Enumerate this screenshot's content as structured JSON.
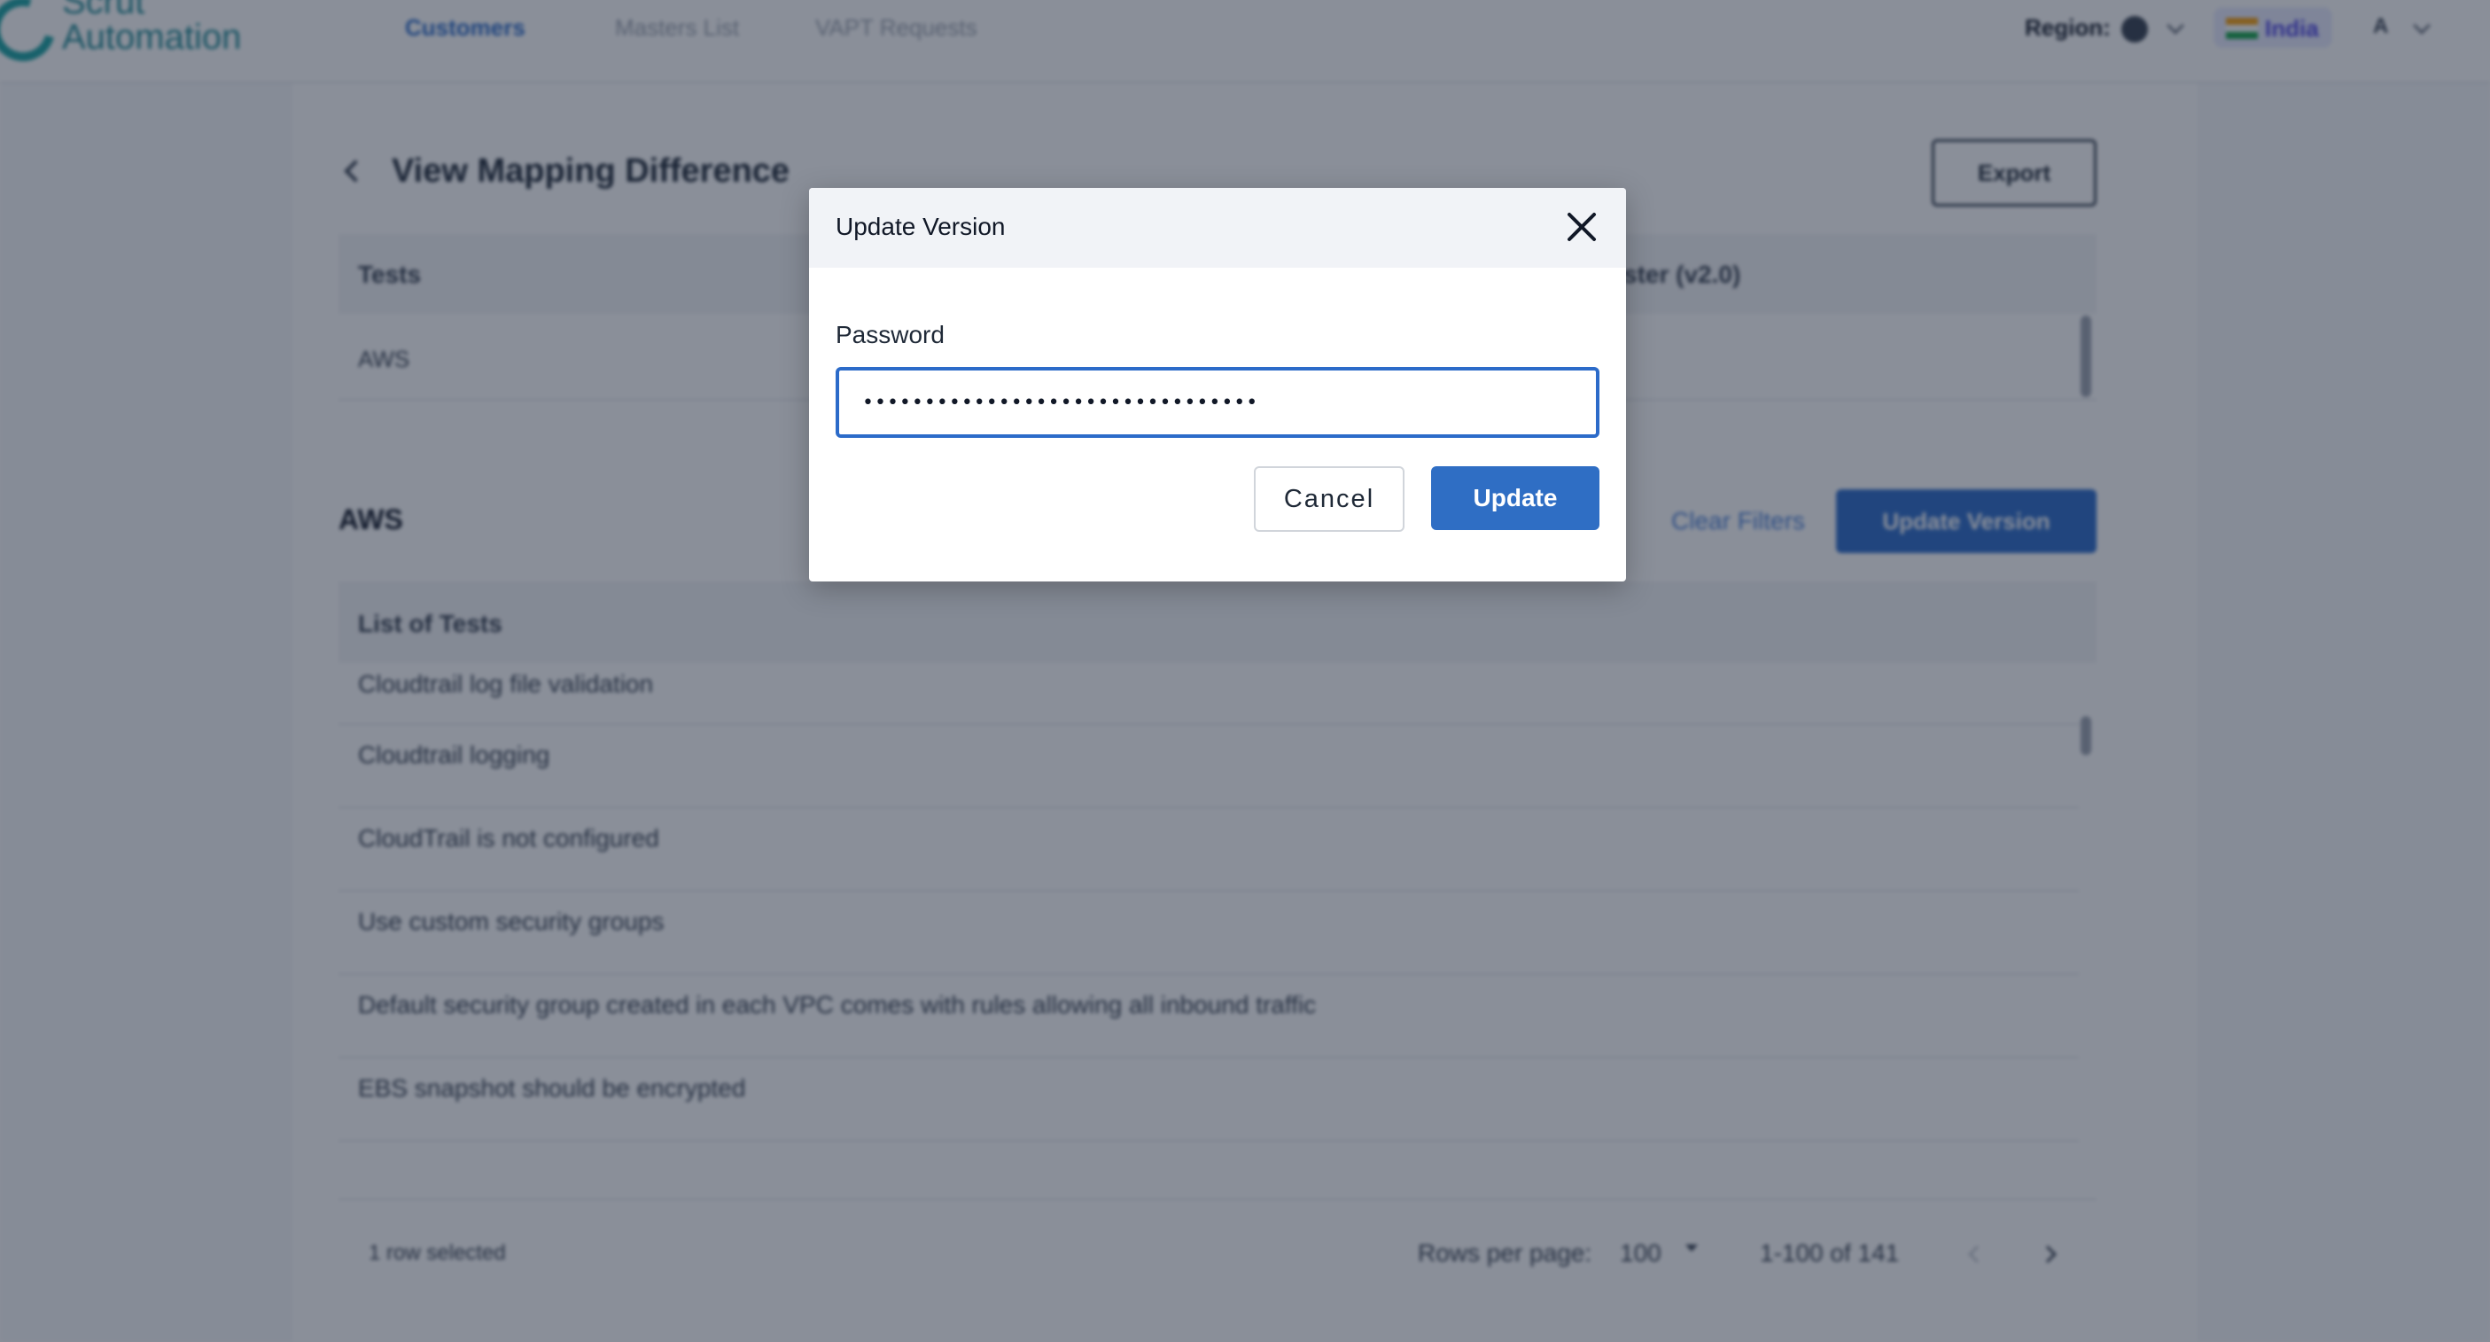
{
  "app": {
    "logo_line1": "Scrut",
    "logo_line2": "Automation",
    "nav": [
      {
        "label": "Customers",
        "active": true
      },
      {
        "label": "Masters List",
        "active": false
      },
      {
        "label": "VAPT Requests",
        "active": false
      }
    ],
    "region_label": "Region:",
    "country": "India",
    "avatar_initial": "A"
  },
  "page": {
    "title": "View Mapping Difference",
    "export_label": "Export",
    "mapping_table": {
      "col1": "Tests",
      "col2": "ster (v2.0)",
      "row1": "AWS"
    },
    "section_title": "AWS",
    "clear_filters_label": "Clear Filters",
    "update_version_label": "Update Version",
    "tests_table": {
      "header": "List of Tests",
      "rows": [
        "Cloudtrail log file validation",
        "Cloudtrail logging",
        "CloudTrail is not configured",
        "Use custom security groups",
        "Default security group created in each VPC comes with rules allowing all inbound traffic",
        "EBS snapshot should be encrypted"
      ]
    },
    "footer": {
      "selected": "1 row selected",
      "rows_per_page_label": "Rows per page:",
      "rows_per_page_value": "100",
      "range": "1-100 of 141"
    }
  },
  "modal": {
    "title": "Update Version",
    "password_label": "Password",
    "password_value": "••••••••••••••••••••••••••••••••",
    "cancel_label": "Cancel",
    "update_label": "Update"
  },
  "colors": {
    "primary": "#2f6ec4",
    "overlay": "rgba(22,32,52,0.5)",
    "link": "#4a7fd6"
  }
}
